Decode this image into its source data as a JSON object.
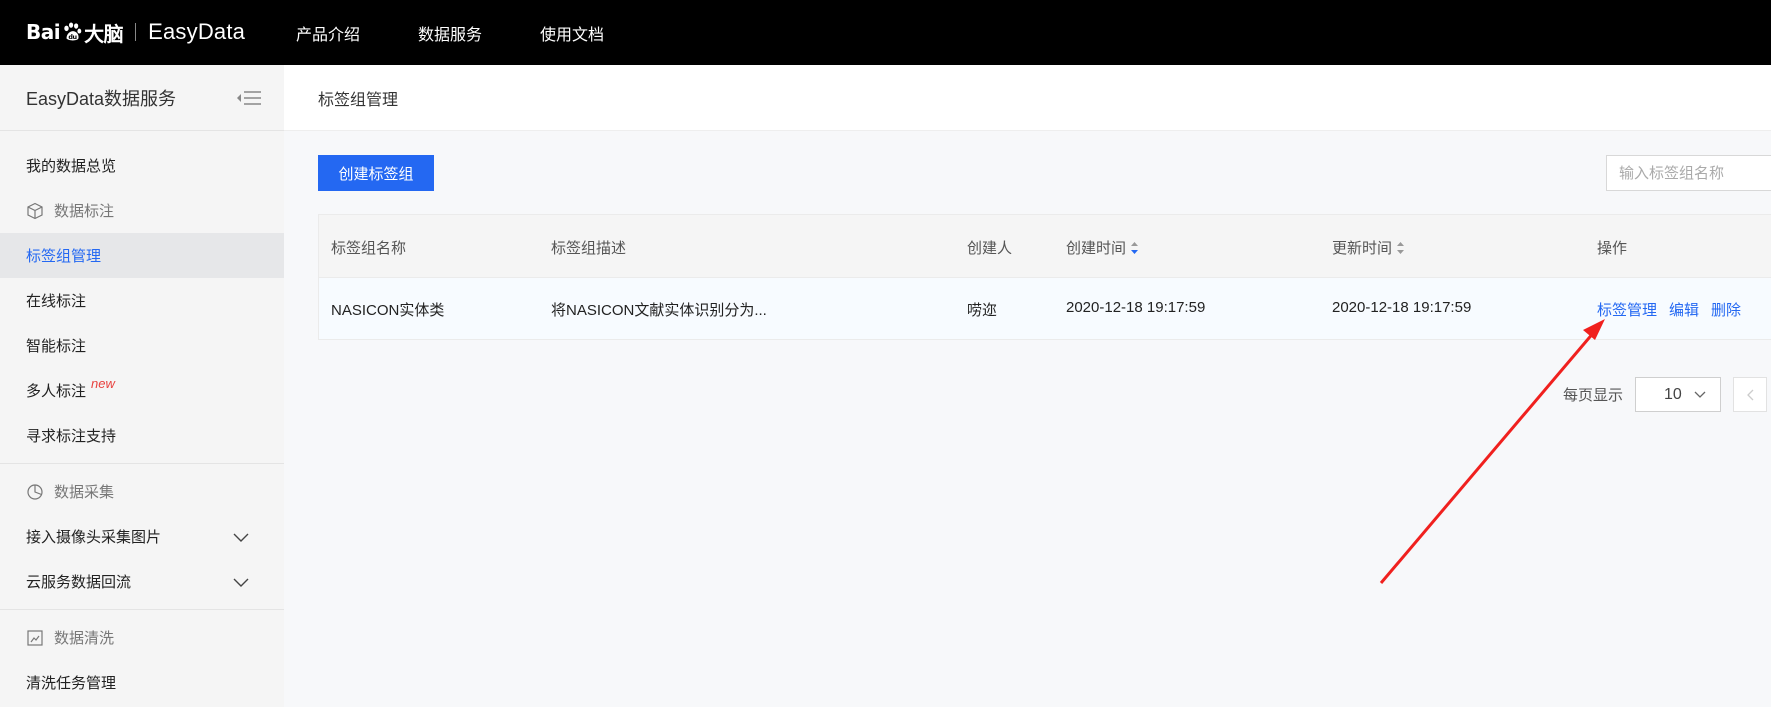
{
  "topbar": {
    "logo_baidu_left": "Bai",
    "logo_baidu_right": "大脑",
    "logo_product": "EasyData",
    "nav": [
      "产品介绍",
      "数据服务",
      "使用文档"
    ]
  },
  "sidebar": {
    "title": "EasyData数据服务",
    "overview": "我的数据总览",
    "group_label": {
      "label": "数据标注",
      "items": [
        {
          "label": "标签组管理",
          "active": true
        },
        {
          "label": "在线标注"
        },
        {
          "label": "智能标注"
        },
        {
          "label": "多人标注",
          "badge": "new"
        },
        {
          "label": "寻求标注支持"
        }
      ]
    },
    "group_collect": {
      "label": "数据采集",
      "items": [
        {
          "label": "接入摄像头采集图片"
        },
        {
          "label": "云服务数据回流"
        }
      ]
    },
    "group_clean": {
      "label": "数据清洗",
      "items": [
        {
          "label": "清洗任务管理"
        }
      ]
    }
  },
  "main": {
    "breadcrumb": "标签组管理",
    "create_button": "创建标签组",
    "search_placeholder": "输入标签组名称",
    "table": {
      "headers": [
        "标签组名称",
        "标签组描述",
        "创建人",
        "创建时间",
        "更新时间",
        "操作"
      ],
      "rows": [
        {
          "name": "NASICON实体类",
          "description": "将NASICON文献实体识别分为...",
          "creator": "唠迩",
          "created": "2020-12-18 19:17:59",
          "updated": "2020-12-18 19:17:59",
          "actions": [
            "标签管理",
            "编辑",
            "删除"
          ]
        }
      ]
    },
    "pager": {
      "label": "每页显示",
      "page_size": "10"
    }
  },
  "colors": {
    "accent": "#2468f2",
    "annotation_arrow": "#f0201e",
    "topbar": "#000000"
  }
}
